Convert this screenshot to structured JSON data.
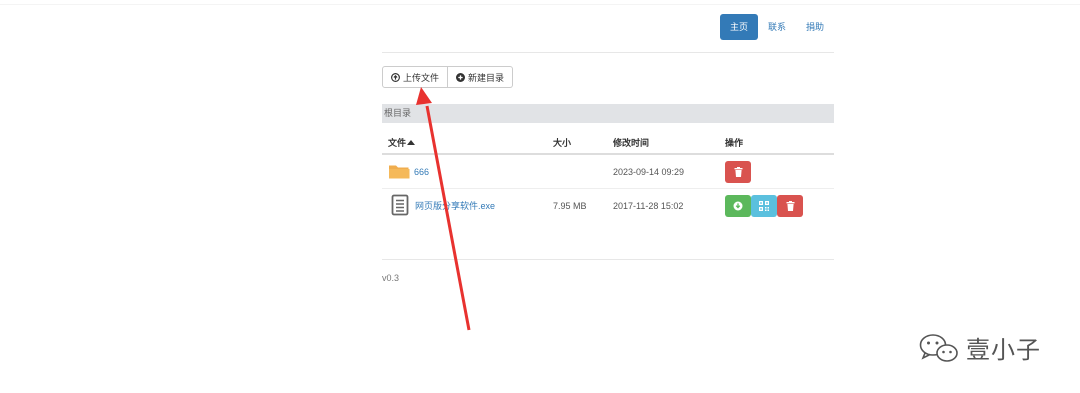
{
  "nav": {
    "items": [
      {
        "label": "主页",
        "active": true
      },
      {
        "label": "联系"
      },
      {
        "label": "捐助"
      }
    ]
  },
  "toolbar": {
    "upload_label": "上传文件",
    "mkdir_label": "新建目录"
  },
  "breadcrumb": {
    "label": "根目录"
  },
  "table": {
    "headers": {
      "name": "文件",
      "size": "大小",
      "mtime": "修改时间",
      "ops": "操作"
    },
    "rows": [
      {
        "type": "folder",
        "name": "666",
        "size": "",
        "mtime": "2023-09-14 09:29"
      },
      {
        "type": "file",
        "name": "网页版分享软件.exe",
        "size": "7.95 MB",
        "mtime": "2017-11-28 15:02"
      }
    ]
  },
  "footer": {
    "version": "v0.3"
  },
  "watermark": {
    "text": "壹小子"
  },
  "colors": {
    "primary": "#337ab7",
    "danger": "#d9534f",
    "success": "#5cb85c",
    "info": "#5bc0de",
    "folder": "#f0ad4e",
    "annotation_arrow": "#e8322f"
  }
}
